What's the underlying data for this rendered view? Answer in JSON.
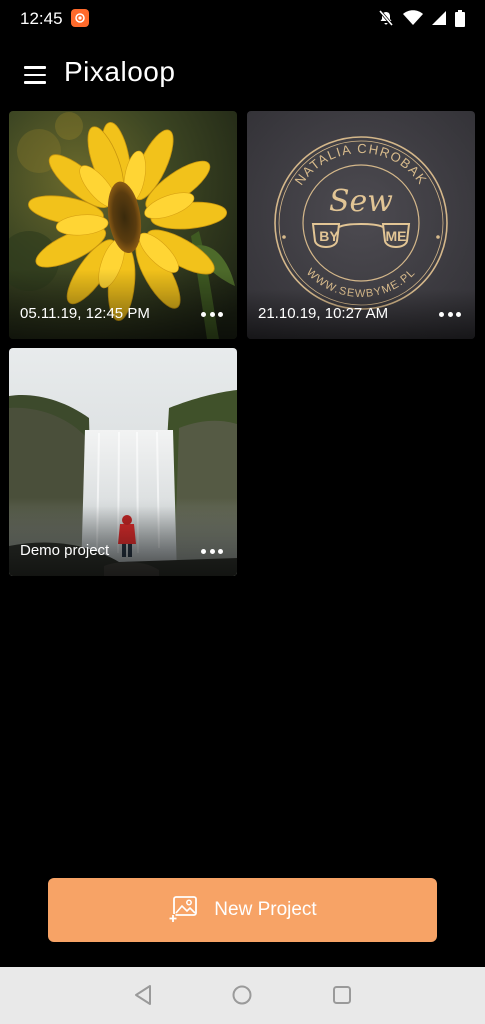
{
  "status_bar": {
    "time": "12:45"
  },
  "app_bar": {
    "title": "Pixaloop"
  },
  "projects": [
    {
      "label": "05.11.19, 12:45 PM",
      "thumbnail": "sunflower"
    },
    {
      "label": "21.10.19, 10:27 AM",
      "thumbnail": "sewn-by-me-logo-stamp"
    },
    {
      "label": "Demo project",
      "thumbnail": "waterfall"
    }
  ],
  "stamp_logo": {
    "top_text": "NATALIA CHROBAK",
    "script_text": "Sew",
    "by_text": "BY",
    "me_text": "ME",
    "bottom_text": "WWW.SEWBYME.PL"
  },
  "new_project_button": {
    "label": "New Project",
    "icon": "add-photo-icon"
  },
  "nav": {
    "back": "back-icon",
    "home": "home-icon",
    "recents": "recents-icon"
  },
  "colors": {
    "accent": "#f7a366",
    "background": "#000000",
    "nav_bar": "#e9e9e9"
  }
}
